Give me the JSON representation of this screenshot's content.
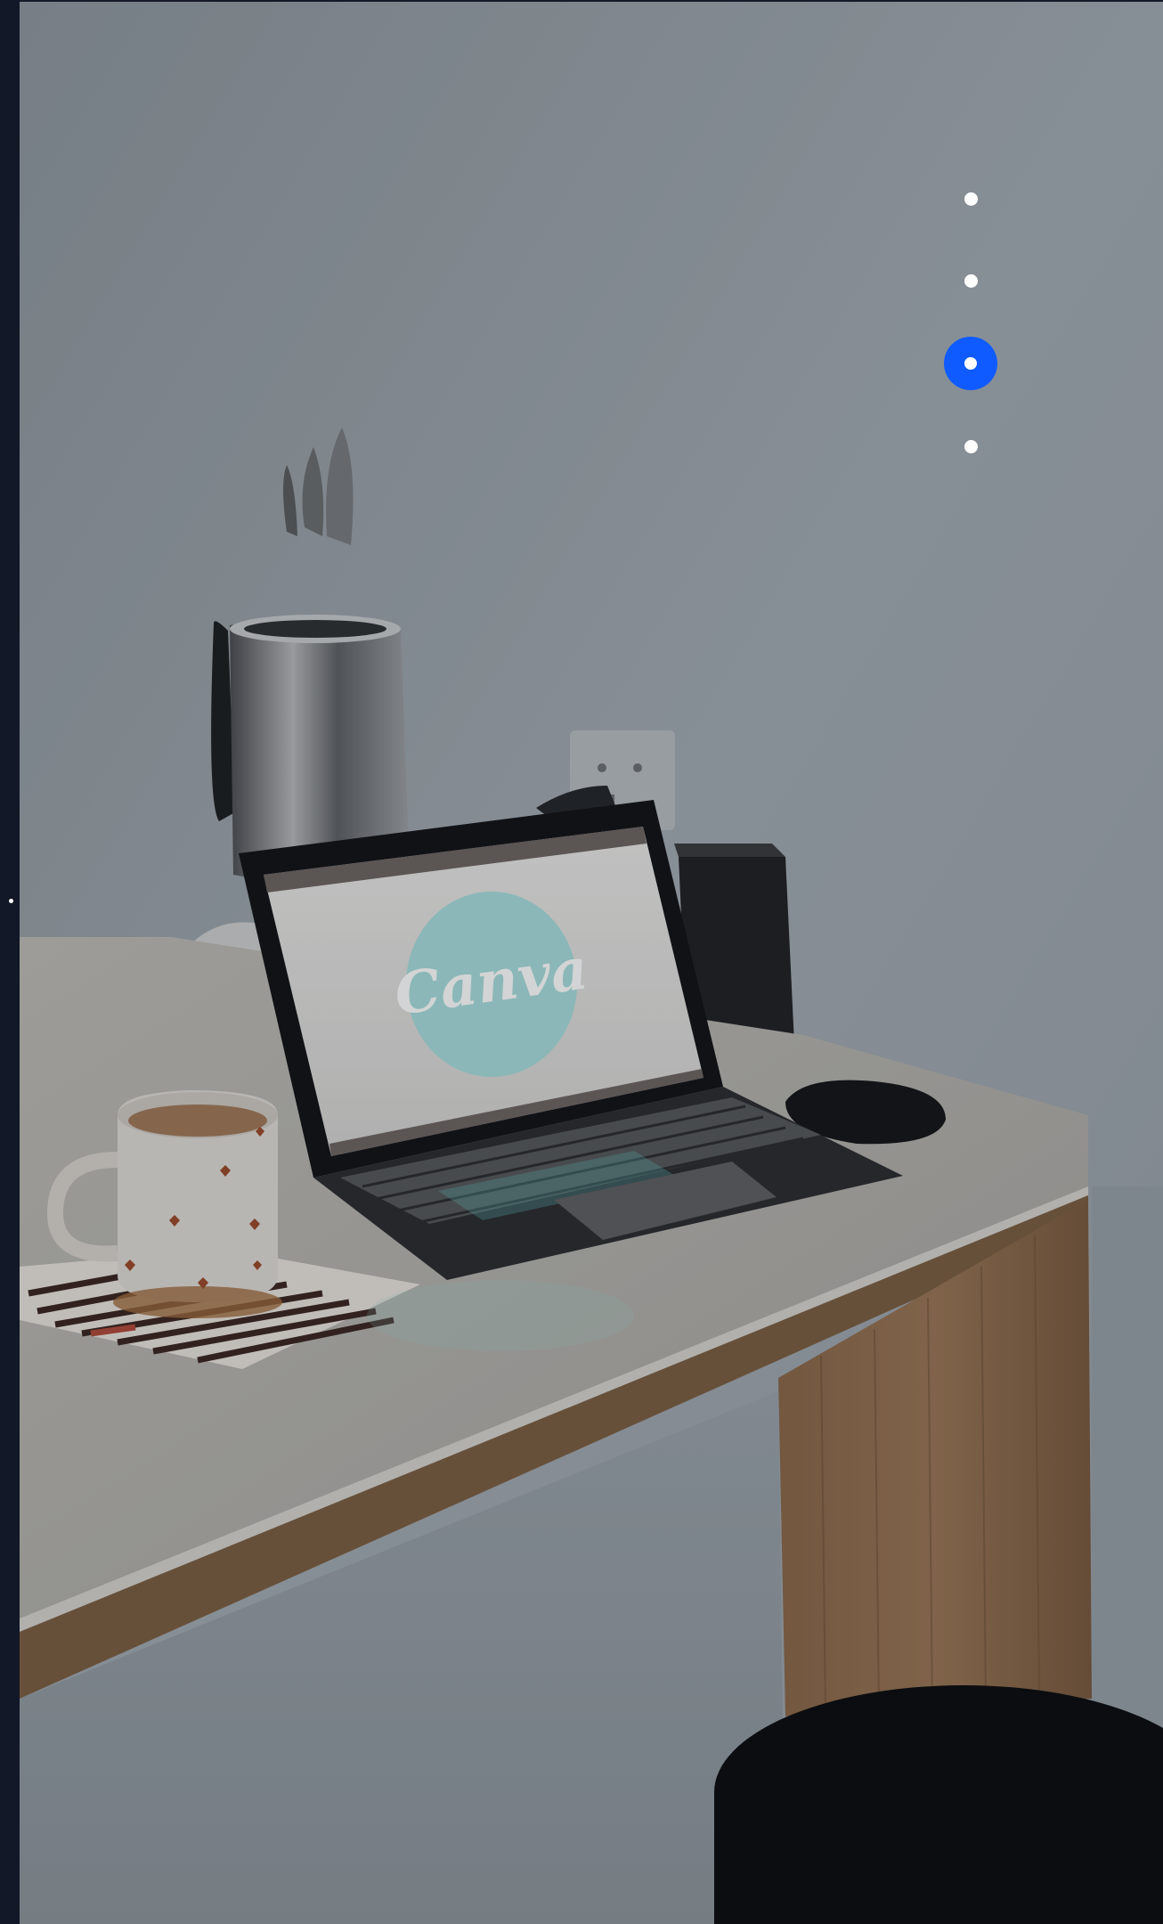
{
  "page": {
    "background": "#151a28"
  },
  "hero": {
    "description_icon": "photo-hero",
    "screen_logo_text": "Canva",
    "screen_logo_color": "#a8dcdc"
  },
  "slide_nav": {
    "dots": [
      {
        "index": 1,
        "active": false
      },
      {
        "index": 2,
        "active": false
      },
      {
        "index": 3,
        "active": true
      },
      {
        "index": 4,
        "active": false
      }
    ],
    "active_color": "#0f5bff",
    "inactive_color": "#ffffff"
  }
}
